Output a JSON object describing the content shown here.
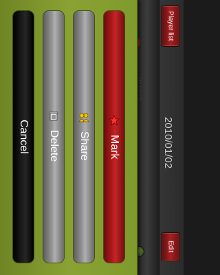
{
  "background": {
    "date": "2010/01/02",
    "list_text": "………"
  },
  "toolbar": {
    "player_list_label": "Player list",
    "edit_label": "Edit"
  },
  "action_sheet": {
    "items": [
      {
        "label": "Cancel",
        "icon": "none"
      },
      {
        "label": "Delete",
        "icon": "trash-icon"
      },
      {
        "label": "Share",
        "icon": "share-people-icon"
      },
      {
        "label": "Mark",
        "icon": "star-icon"
      }
    ]
  },
  "colors": {
    "sheet_green": "#8aa233",
    "mark_red": "#b81c1c",
    "cancel_black": "#000000",
    "button_gray": "#9a9a9a"
  }
}
